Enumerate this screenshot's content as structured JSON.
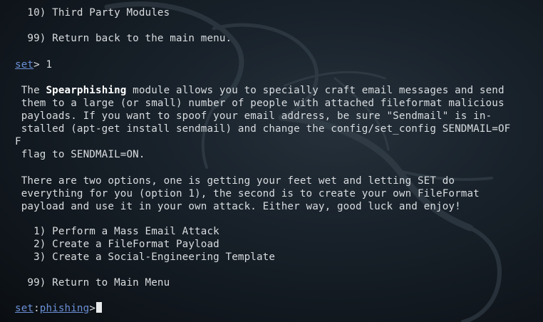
{
  "terminal": {
    "menu_item_10": "  10) Third Party Modules",
    "menu_item_99": "  99) Return back to the main menu.",
    "prompt1": {
      "set": "set",
      "symbol": "> ",
      "input": "1"
    },
    "description": {
      "line1_pre": " The ",
      "line1_bold": "Spearphishing",
      "line1_post": " module allows you to specially craft email messages and send",
      "line2": " them to a large (or small) number of people with attached fileformat malicious",
      "line3": " payloads. If you want to spoof your email address, be sure \"Sendmail\" is in-",
      "line4": " stalled (apt-get install sendmail) and change the config/set_config SENDMAIL=OF",
      "line5": "F",
      "line6": " flag to SENDMAIL=ON."
    },
    "options_intro": {
      "line1": " There are two options, one is getting your feet wet and letting SET do",
      "line2": " everything for you (option 1), the second is to create your own FileFormat",
      "line3": " payload and use it in your own attack. Either way, good luck and enjoy!"
    },
    "options": [
      "   1) Perform a Mass Email Attack",
      "   2) Create a FileFormat Payload",
      "   3) Create a Social-Engineering Template"
    ],
    "return_option": "  99) Return to Main Menu",
    "prompt2": {
      "set": "set",
      "colon": ":",
      "module": "phishing",
      "symbol": ">"
    }
  }
}
